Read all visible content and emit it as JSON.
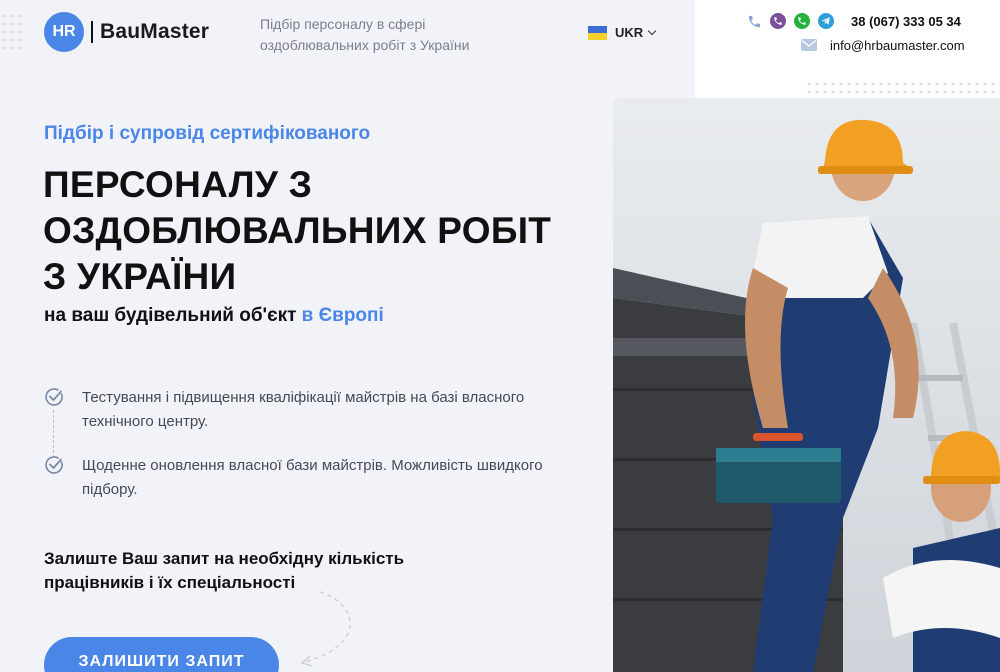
{
  "header": {
    "logo_badge": "HR",
    "logo_text": "BauMaster",
    "tagline": "Підбір персоналу в сфері оздоблювальних робіт з України",
    "language": "UKR",
    "phone": "38 (067) 333 05 34",
    "email": "info@hrbaumaster.com",
    "contact_icons": [
      "phone-icon",
      "viber-icon",
      "whatsapp-icon",
      "telegram-icon"
    ]
  },
  "hero": {
    "subheading": "Підбір і супровід сертифікованого",
    "headline_lines": [
      "ПЕРСОНАЛУ З",
      "ОЗДОБЛЮВАЛЬНИХ РОБІТ",
      "З УКРАЇНИ"
    ],
    "subline_prefix": "на ваш будівельний об'єкт ",
    "subline_accent": "в Європі",
    "features": [
      "Тестування і підвищення кваліфікації майстрів на базі власного технічного центру.",
      "Щоденне оновлення власної бази майстрів. Можливість швидкого підбору."
    ],
    "cta_text": "Залиште Ваш запит на необхідну кількість працівників і їх спеціальності",
    "cta_button": "ЗАЛИШИТИ ЗАПИТ"
  },
  "colors": {
    "accent": "#4a86e8",
    "background": "#f1f3f9",
    "helmet": "#f2a024"
  }
}
